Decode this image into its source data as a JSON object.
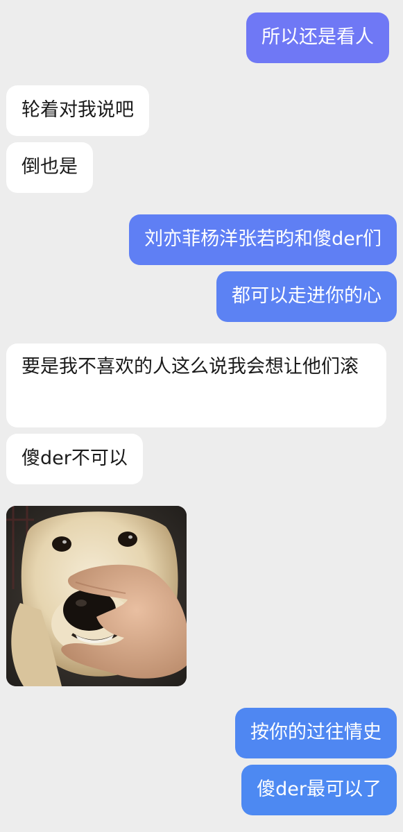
{
  "colors": {
    "background": "#ededed",
    "incoming_bubble": "#ffffff",
    "outgoing_bubble_top": "#6f78f5",
    "outgoing_bubble_mid": "#5e80f3",
    "outgoing_bubble_bottom": "#4f87f2"
  },
  "messages": [
    {
      "id": "m1",
      "direction": "outgoing",
      "type": "text",
      "text": "所以还是看人"
    },
    {
      "id": "m2",
      "direction": "incoming",
      "type": "text",
      "text": "轮着对我说吧"
    },
    {
      "id": "m3",
      "direction": "incoming",
      "type": "text",
      "text": "倒也是"
    },
    {
      "id": "m4",
      "direction": "outgoing",
      "type": "text",
      "text": "刘亦菲杨洋张若昀和傻der们"
    },
    {
      "id": "m5",
      "direction": "outgoing",
      "type": "text",
      "text": "都可以走进你的心"
    },
    {
      "id": "m6",
      "direction": "incoming",
      "type": "text",
      "text": "要是我不喜欢的人这么说我会想让他们滚"
    },
    {
      "id": "m7",
      "direction": "incoming",
      "type": "text",
      "text": "傻der不可以"
    },
    {
      "id": "m8",
      "direction": "incoming",
      "type": "image",
      "image": "meme-dog-with-hand-on-nose"
    },
    {
      "id": "m9",
      "direction": "outgoing",
      "type": "text",
      "text": "按你的过往情史"
    },
    {
      "id": "m10",
      "direction": "outgoing",
      "type": "text",
      "text": "傻der最可以了"
    }
  ]
}
